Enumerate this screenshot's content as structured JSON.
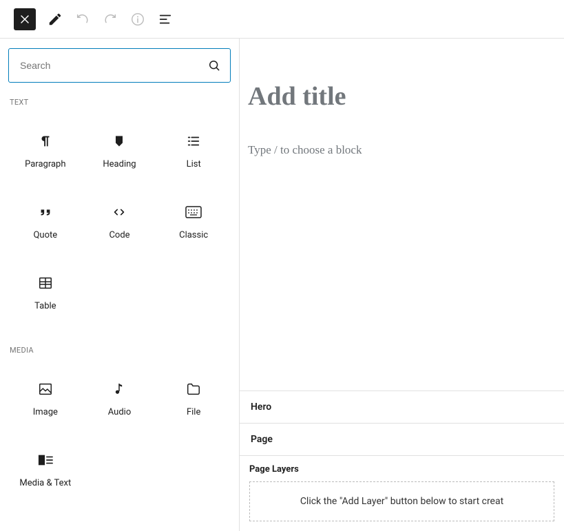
{
  "search": {
    "placeholder": "Search"
  },
  "sections": {
    "text": {
      "label": "TEXT",
      "items": [
        {
          "label": "Paragraph"
        },
        {
          "label": "Heading"
        },
        {
          "label": "List"
        },
        {
          "label": "Quote"
        },
        {
          "label": "Code"
        },
        {
          "label": "Classic"
        },
        {
          "label": "Table"
        }
      ]
    },
    "media": {
      "label": "MEDIA",
      "items": [
        {
          "label": "Image"
        },
        {
          "label": "Audio"
        },
        {
          "label": "File"
        },
        {
          "label": "Media & Text"
        }
      ]
    }
  },
  "editor": {
    "title_placeholder": "Add title",
    "content_placeholder": "Type / to choose a block"
  },
  "stack": {
    "rows": [
      {
        "label": "Hero"
      },
      {
        "label": "Page"
      }
    ],
    "page_layers_label": "Page Layers",
    "drop_hint": "Click the \"Add Layer\" button below to start creat"
  }
}
